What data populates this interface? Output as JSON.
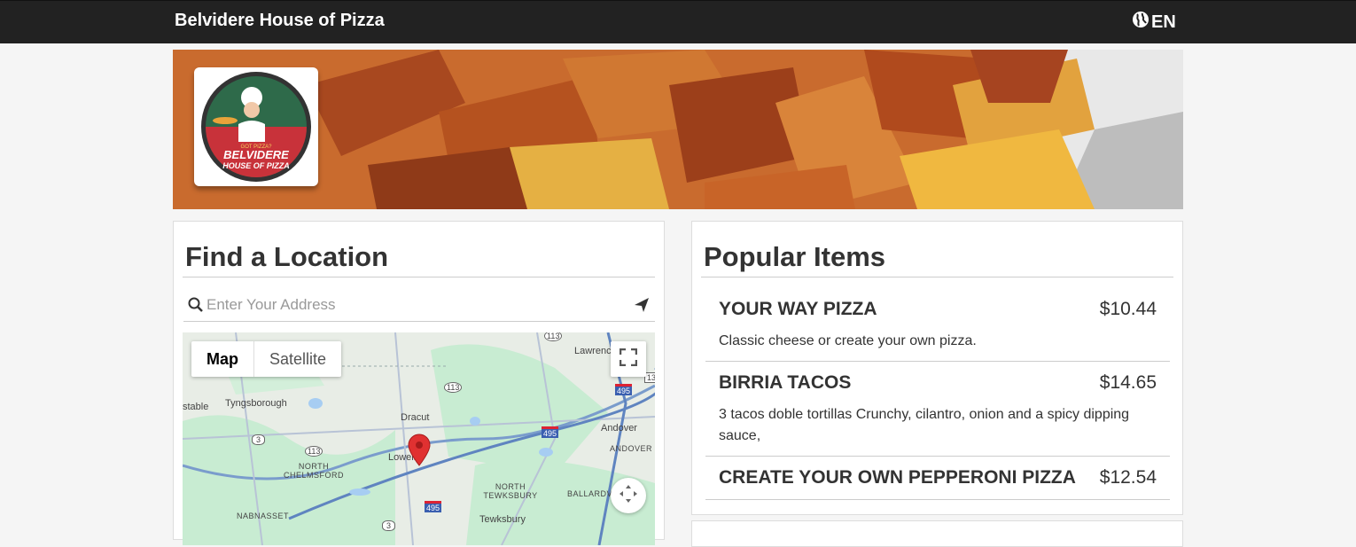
{
  "header": {
    "title": "Belvidere House of Pizza",
    "language": "EN",
    "globe_icon": "globe-icon"
  },
  "hero": {
    "logo_top": "GOT PIZZA?",
    "logo_line1": "BELVIDERE",
    "logo_line2": "HOUSE OF PIZZA"
  },
  "location": {
    "title": "Find a Location",
    "search_placeholder": "Enter Your Address",
    "map_tab": "Map",
    "satellite_tab": "Satellite",
    "labels": {
      "tyngsborough": "Tyngsborough",
      "dracut": "Dracut",
      "lowell": "Lowell",
      "north_chelmsford": "NORTH CHELMSFORD",
      "north_tewksbury": "NORTH TEWKSBURY",
      "andover": "Andover",
      "andover_caps": "ANDOVER",
      "ballardvale": "BALLARDV",
      "nabnasset": "NABNASSET",
      "tewksbury": "Tewksbury",
      "lawrence": "Lawrenc",
      "stable": "stable",
      "r113a": "113",
      "r113b": "113",
      "r113c": "113",
      "r3a": "3",
      "r3b": "3",
      "i495a": "495",
      "i495b": "495",
      "i495c": "495",
      "r13": "13"
    }
  },
  "popular": {
    "title": "Popular Items",
    "items": [
      {
        "name": "YOUR WAY PIZZA",
        "price": "$10.44",
        "desc": "Classic cheese or create your own pizza."
      },
      {
        "name": "BIRRIA TACOS",
        "price": "$14.65",
        "desc": "3 tacos doble tortillas Crunchy, cilantro, onion and a spicy dipping sauce,"
      },
      {
        "name": "CREATE YOUR OWN PEPPERONI PIZZA",
        "price": "$12.54",
        "desc": ""
      }
    ]
  },
  "colors": {
    "topbar": "#222222",
    "marker": "#e03131",
    "map_green": "#c8ecd2"
  }
}
